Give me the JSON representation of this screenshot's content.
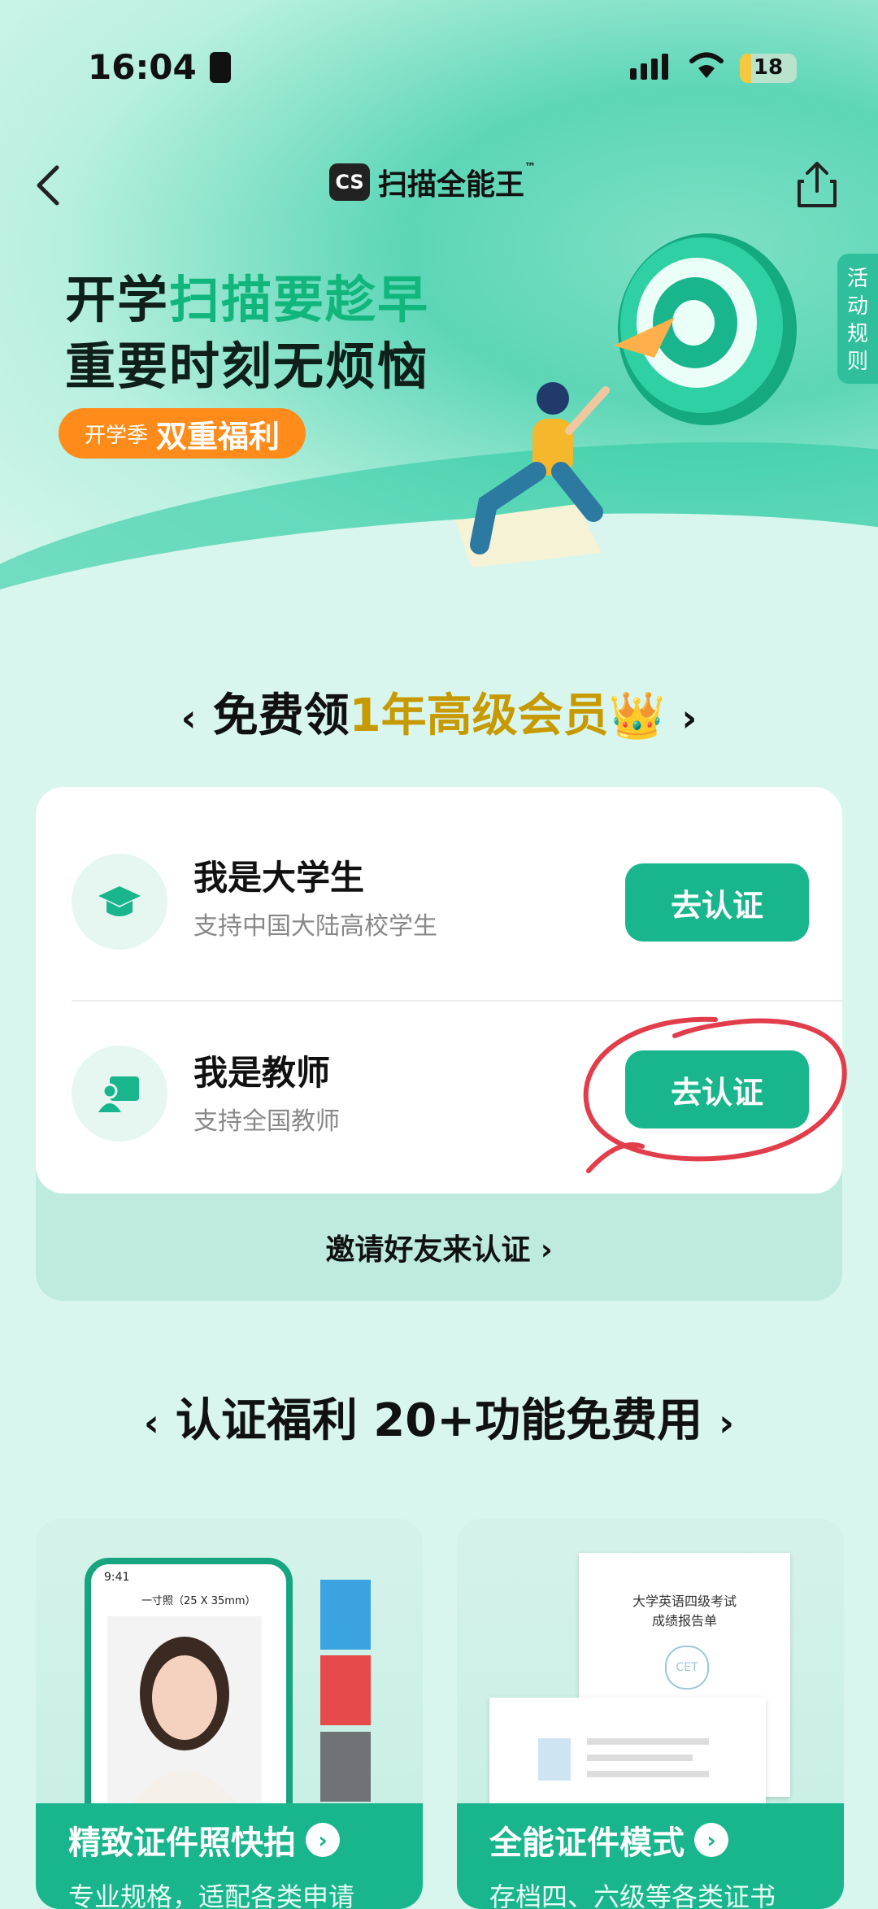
{
  "status_bar": {
    "time": "16:04",
    "battery": "18"
  },
  "nav": {
    "logo_badge": "CS",
    "app_name": "扫描全能王",
    "tm": "™"
  },
  "hero": {
    "line1_prefix": "开学",
    "line1_highlight": "扫描要趁早",
    "line2": "重要时刻无烦恼",
    "pill_small": "开学季",
    "pill_big": "双重福利",
    "rules_tab": "活动规则"
  },
  "membership": {
    "title_prefix": "免费领",
    "title_gold": "1年高级会员",
    "crown": "👑"
  },
  "verify": {
    "student_title": "我是大学生",
    "student_sub": "支持中国大陆高校学生",
    "student_button": "去认证",
    "teacher_title": "我是教师",
    "teacher_sub": "支持全国教师",
    "teacher_button": "去认证",
    "invite": "邀请好友来认证 ›"
  },
  "benefits": {
    "title": "认证福利  20+功能免费用"
  },
  "features": [
    {
      "title": "精致证件照快拍",
      "sub": "专业规格，适配各类申请",
      "phone_time": "9:41",
      "phone_header": "一寸照（25 X 35mm）"
    },
    {
      "title": "全能证件模式",
      "sub": "存档四、六级等各类证书",
      "doc_title": "大学英语四级考试",
      "doc_sub": "成绩报告单",
      "doc_logo": "CET"
    }
  ],
  "colors": {
    "accent": "#19b58c",
    "highlight_green": "#11b67c",
    "gold": "#c79a00",
    "orange_pill": "#ff8c1a",
    "annotation_red": "#e23d4b"
  }
}
